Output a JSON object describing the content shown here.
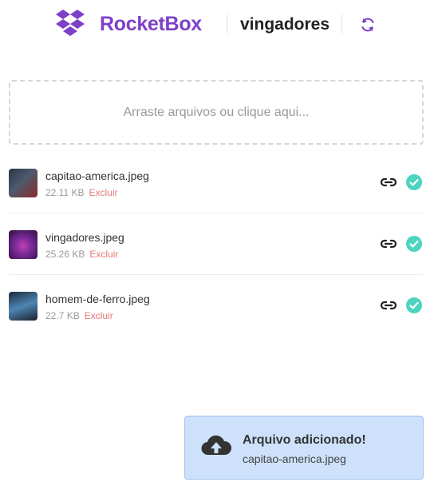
{
  "header": {
    "brand": "RocketBox",
    "box_name": "vingadores",
    "brand_color": "#7d40c7",
    "logo_icon": "dropbox-logo-icon",
    "refresh_icon": "refresh-icon"
  },
  "dropzone": {
    "text": "Arraste arquivos ou clique aqui..."
  },
  "files": [
    {
      "name": "capitao-america.jpeg",
      "size": "22.11 KB",
      "delete_label": "Excluir",
      "status": "uploaded",
      "thumb_colors": [
        "#2a3548",
        "#8a2a2a"
      ]
    },
    {
      "name": "vingadores.jpeg",
      "size": "25.26 KB",
      "delete_label": "Excluir",
      "status": "uploaded",
      "thumb_colors": [
        "#3a1450",
        "#c23fb0"
      ]
    },
    {
      "name": "homem-de-ferro.jpeg",
      "size": "22.7 KB",
      "delete_label": "Excluir",
      "status": "uploaded",
      "thumb_colors": [
        "#1b2a3a",
        "#4f86b5"
      ]
    }
  ],
  "colors": {
    "success": "#4cd4c0",
    "danger": "#e57878",
    "toast_bg": "#cde1fb"
  },
  "toast": {
    "title": "Arquivo adicionado!",
    "text": "capitao-america.jpeg",
    "icon": "cloud-upload-icon"
  }
}
